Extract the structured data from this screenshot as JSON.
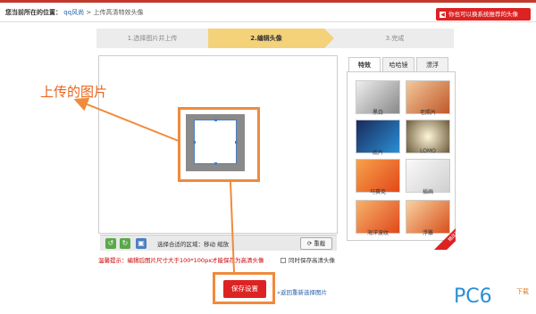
{
  "breadcrumb": {
    "prefix": "您当前所在的位置：",
    "site": "qq风尚",
    "sep": ">",
    "page": "上传高清特效头像"
  },
  "header_button": {
    "label": "你也可以换系统推荐的头像"
  },
  "steps": [
    {
      "label": "1.选择图片并上传"
    },
    {
      "label": "2.编辑头像"
    },
    {
      "label": "3.完成"
    }
  ],
  "toolbar": {
    "hint": "选择合适的区域：移动  缩放",
    "reset_label": "重截"
  },
  "tip": "温馨提示：编辑后图片尺寸大于100*100px才能保存为高清头像",
  "hq_option": "同时保存高清头像",
  "save_label": "保存设置",
  "reselect_label": "返回重新选择图片",
  "annotation": "上传的图片",
  "fx_tabs": [
    {
      "label": "特效"
    },
    {
      "label": "哈哈镜"
    },
    {
      "label": "漂浮"
    }
  ],
  "effects": [
    {
      "name": "黑白"
    },
    {
      "name": "老照片"
    },
    {
      "name": "底片"
    },
    {
      "name": "LOMO"
    },
    {
      "name": "马赛克"
    },
    {
      "name": "插画"
    },
    {
      "name": "海洋波纹"
    },
    {
      "name": "浮雕"
    }
  ],
  "corner_badge": "精品推荐",
  "logo": {
    "main": "PC6",
    "sub": "下载"
  },
  "colors": {
    "accent": "#dd2222",
    "annotation": "#f08a3c"
  }
}
